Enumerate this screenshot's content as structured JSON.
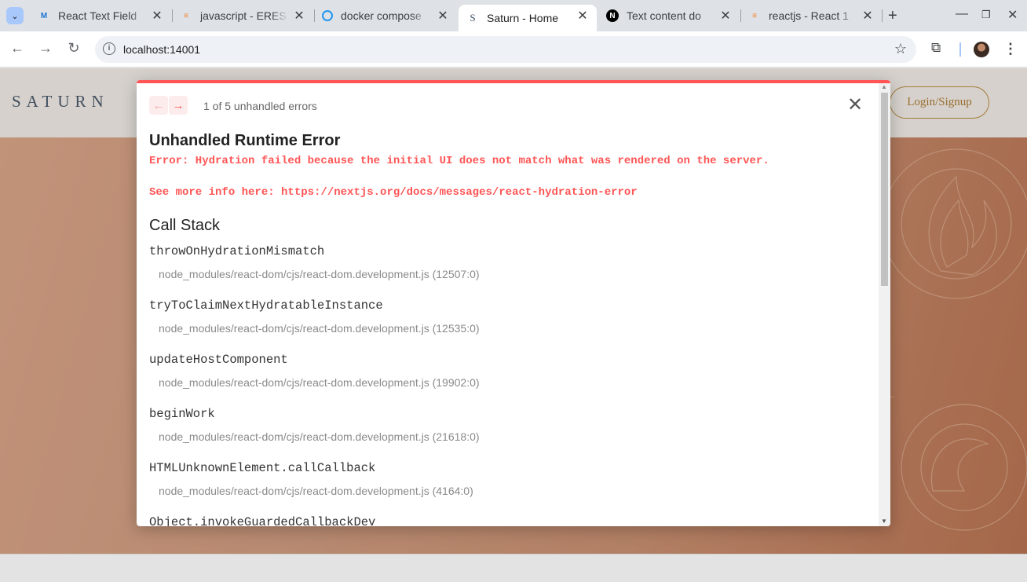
{
  "browser": {
    "tabs": [
      {
        "title": "React Text Field",
        "favicon": "mui-icon",
        "color": "#1976d2"
      },
      {
        "title": "javascript - ERES",
        "favicon": "stackoverflow-icon",
        "color": "#f48024"
      },
      {
        "title": "docker compose",
        "favicon": "docker-icon",
        "color": "#2496ed"
      },
      {
        "title": "Saturn - Home",
        "favicon": "saturn-icon",
        "color": "#3f5369",
        "active": true
      },
      {
        "title": "Text content do",
        "favicon": "nextjs-icon",
        "color": "#000000"
      },
      {
        "title": "reactjs - React 1",
        "favicon": "stackoverflow-icon",
        "color": "#f48024"
      }
    ],
    "tab_close": "✕",
    "new_tab": "+",
    "url": "localhost:14001"
  },
  "site": {
    "logo": "SATURN",
    "login_label": "Login/Signup"
  },
  "error_overlay": {
    "nav_prev": "←",
    "nav_next": "→",
    "count_text": "1 of 5 unhandled errors",
    "close": "✕",
    "title": "Unhandled Runtime Error",
    "message": "Error: Hydration failed because the initial UI does not match what was rendered on the server.",
    "more_info": "See more info here: https://nextjs.org/docs/messages/react-hydration-error",
    "call_stack_title": "Call Stack",
    "frames": [
      {
        "fn": "throwOnHydrationMismatch",
        "loc": "node_modules/react-dom/cjs/react-dom.development.js (12507:0)"
      },
      {
        "fn": "tryToClaimNextHydratableInstance",
        "loc": "node_modules/react-dom/cjs/react-dom.development.js (12535:0)"
      },
      {
        "fn": "updateHostComponent",
        "loc": "node_modules/react-dom/cjs/react-dom.development.js (19902:0)"
      },
      {
        "fn": "beginWork",
        "loc": "node_modules/react-dom/cjs/react-dom.development.js (21618:0)"
      },
      {
        "fn": "HTMLUnknownElement.callCallback",
        "loc": "node_modules/react-dom/cjs/react-dom.development.js (4164:0)"
      },
      {
        "fn": "Object.invokeGuardedCallbackDev",
        "loc": ""
      }
    ]
  },
  "colors": {
    "error_red": "#ff5555",
    "brand_gold": "#a9782f",
    "logo_blue": "#3f5369"
  }
}
